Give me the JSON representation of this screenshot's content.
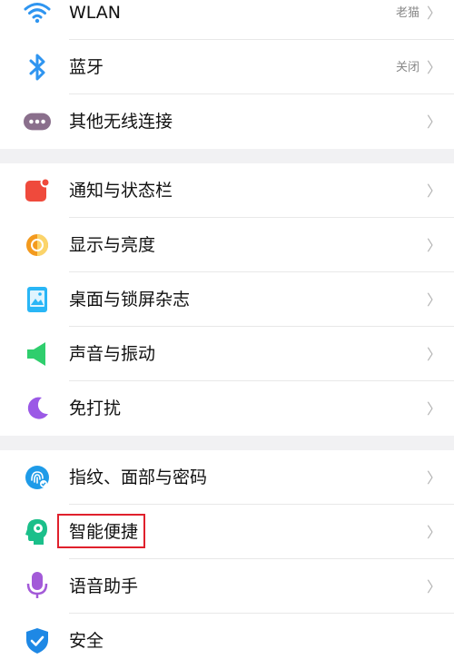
{
  "settings": {
    "group1": [
      {
        "label": "WLAN",
        "value": "老猫",
        "icon": "wifi-icon"
      },
      {
        "label": "蓝牙",
        "value": "关闭",
        "icon": "bluetooth-icon"
      },
      {
        "label": "其他无线连接",
        "value": "",
        "icon": "more-connections-icon"
      }
    ],
    "group2": [
      {
        "label": "通知与状态栏",
        "icon": "notification-icon"
      },
      {
        "label": "显示与亮度",
        "icon": "display-brightness-icon"
      },
      {
        "label": "桌面与锁屏杂志",
        "icon": "wallpaper-icon"
      },
      {
        "label": "声音与振动",
        "icon": "speaker-icon"
      },
      {
        "label": "免打扰",
        "icon": "moon-icon"
      }
    ],
    "group3": [
      {
        "label": "指纹、面部与密码",
        "icon": "fingerprint-icon"
      },
      {
        "label": "智能便捷",
        "icon": "smart-assist-icon"
      },
      {
        "label": "语音助手",
        "icon": "microphone-icon"
      },
      {
        "label": "安全",
        "icon": "shield-icon"
      }
    ],
    "chevron": "〉"
  },
  "colors": {
    "wifi": "#2f95f0",
    "bluetooth": "#2f95f0",
    "more": "#8a6f8c",
    "notification": "#ef4a3c",
    "display": "#f39a1e",
    "wallpaper": "#29b6f6",
    "speaker": "#2fce6d",
    "moon": "#9b59e6",
    "fingerprint": "#1e9be8",
    "smart": "#1bbf8a",
    "mic": "#a35ad8",
    "shield": "#1e88e5",
    "highlight": "#e0202c"
  }
}
